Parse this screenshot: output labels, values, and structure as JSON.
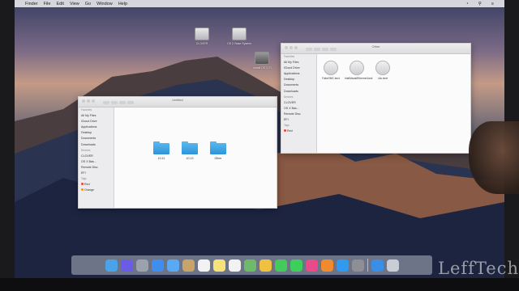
{
  "menubar": {
    "items": [
      "Finder",
      "File",
      "Edit",
      "View",
      "Go",
      "Window",
      "Help"
    ]
  },
  "desktop_icons": [
    {
      "label": "CLOVER"
    },
    {
      "label": "OS X Base System"
    },
    {
      "label": "Install OS X El"
    }
  ],
  "window_left": {
    "title": "Untitled",
    "sidebar": [
      {
        "label": "Favorites",
        "header": true
      },
      {
        "label": "All My Files"
      },
      {
        "label": "iCloud Drive"
      },
      {
        "label": "Applications"
      },
      {
        "label": "Desktop"
      },
      {
        "label": "Documents"
      },
      {
        "label": "Downloads"
      },
      {
        "label": "Devices",
        "header": true
      },
      {
        "label": "CLOVER"
      },
      {
        "label": "OS X Bas..."
      },
      {
        "label": "Remote Disc"
      },
      {
        "label": "EFI"
      },
      {
        "label": "Tags",
        "header": true
      },
      {
        "label": "Red",
        "color": "#ff3b30"
      },
      {
        "label": "Orange",
        "color": "#ff9500"
      }
    ],
    "folders": [
      "10.11",
      "10.13",
      "Other"
    ]
  },
  "window_right": {
    "title": "Other",
    "sidebar": [
      {
        "label": "Favorites",
        "header": true
      },
      {
        "label": "All My Files"
      },
      {
        "label": "iCloud Drive"
      },
      {
        "label": "Applications"
      },
      {
        "label": "Desktop"
      },
      {
        "label": "Documents"
      },
      {
        "label": "Downloads"
      },
      {
        "label": "Devices",
        "header": true
      },
      {
        "label": "CLOVER"
      },
      {
        "label": "OS X Bas..."
      },
      {
        "label": "Remote Disc"
      },
      {
        "label": "EFI"
      },
      {
        "label": "Tags",
        "header": true
      },
      {
        "label": "Red",
        "color": "#ff3b30"
      }
    ],
    "files": [
      "FakeSMC.kext",
      "IntelMausiEthernet.kext",
      "Lilu.kext"
    ]
  },
  "dock_icons": [
    "finder-icon",
    "siri-icon",
    "launchpad-icon",
    "safari-icon",
    "mail-icon",
    "contacts-icon",
    "calendar-icon",
    "notes-icon",
    "reminders-icon",
    "maps-icon",
    "photos-icon",
    "messages-icon",
    "facetime-icon",
    "itunes-icon",
    "ibooks-icon",
    "appstore-icon",
    "preferences-icon",
    "downloads-icon",
    "trash-icon"
  ],
  "dock_colors": [
    "#4aa3e8",
    "#6b5ce7",
    "#9aa3ad",
    "#3e8ef0",
    "#5aa9f5",
    "#c7a46a",
    "#f2f2f2",
    "#f6e27a",
    "#f2f2f2",
    "#6dbb6a",
    "#f0c040",
    "#45c95c",
    "#3ccf5a",
    "#e94a8a",
    "#f08a2c",
    "#2f9af0",
    "#8d8f94",
    "#3a8ee6",
    "#c9ced6"
  ],
  "watermark": "LeffTech"
}
